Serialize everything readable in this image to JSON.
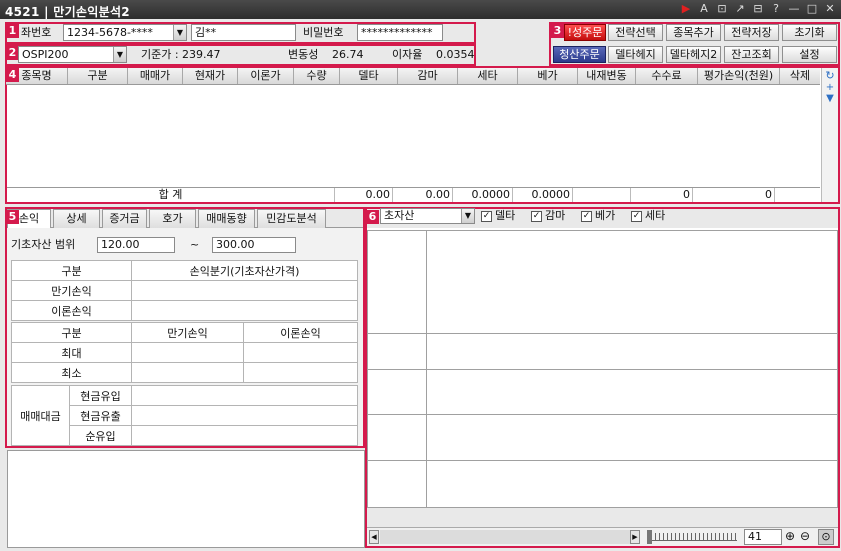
{
  "window": {
    "screen_no": "4521",
    "title": "만기손익분석2",
    "title_buttons": [
      "▶",
      "A",
      "⊡",
      "↗",
      "⊟",
      "?",
      "—",
      "□",
      "✕"
    ]
  },
  "section1": {
    "badge": "1",
    "account_label": "좌번호",
    "account_value": "1234-5678-****",
    "name_value": "김**",
    "password_label": "비밀번호",
    "password_value": "*************"
  },
  "section2": {
    "badge": "2",
    "product_value": "OSPI200",
    "base_price": "기준가 : 239.47",
    "volatility_label": "변동성",
    "volatility_value": "26.74",
    "interest_label": "이자율",
    "interest_value": "0.0354"
  },
  "section3": {
    "badge": "3",
    "buttons_row1": [
      "!성주문",
      "전략선택",
      "종목추가",
      "전략저장",
      "초기화"
    ],
    "buttons_row2": [
      "청산주문",
      "델타헤지",
      "델타헤지2",
      "잔고조회",
      "설정"
    ]
  },
  "section4": {
    "badge": "4",
    "columns": [
      "종목명",
      "구분",
      "매매가",
      "현재가",
      "이론가",
      "수량",
      "델타",
      "감마",
      "세타",
      "베가",
      "내재변동",
      "수수료",
      "평가손익(천원)",
      "삭제"
    ],
    "total_label": "합 계",
    "totals": [
      "0.00",
      "0.00",
      "0.0000",
      "0.0000",
      "0",
      "0"
    ]
  },
  "section5": {
    "badge": "5",
    "tabs": [
      "손익",
      "상세",
      "증거금",
      "호가",
      "매매동향",
      "민감도분석"
    ],
    "range_label": "기초자산 범위",
    "range_from": "120.00",
    "range_sep": "~",
    "range_to": "300.00",
    "table1": {
      "header": [
        "구분",
        "손익분기(기초자산가격)"
      ],
      "rows": [
        "만기손익",
        "이론손익"
      ]
    },
    "table2": {
      "header": [
        "구분",
        "만기손익",
        "이론손익"
      ],
      "rows": [
        "최대",
        "최소"
      ]
    },
    "table3": {
      "group_label": "매매대금",
      "rows": [
        "현금유입",
        "현금유출",
        "순유입"
      ]
    }
  },
  "section6": {
    "badge": "6",
    "select_value": "초자산",
    "checks": [
      "델타",
      "감마",
      "베가",
      "세타"
    ],
    "zoom_value": "41"
  }
}
